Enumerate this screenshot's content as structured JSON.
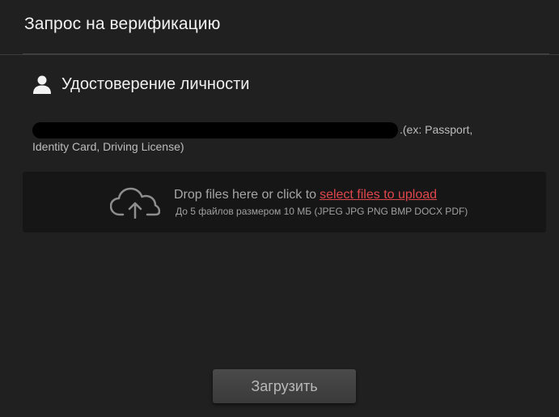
{
  "dialog": {
    "title": "Запрос на верификацию"
  },
  "section": {
    "icon": "user-icon",
    "title": "Удостоверение личности",
    "description_suffix": ".(ex: Passport, Identity Card, Driving License)"
  },
  "dropzone": {
    "icon": "cloud-upload-icon",
    "prompt": "Drop files here or click to",
    "link_label": "select files to upload",
    "hint": "До 5 файлов размером 10 МБ (JPEG JPG PNG BMP DOCX PDF)",
    "link_color": "#e0474c"
  },
  "actions": {
    "submit_label": "Загрузить"
  }
}
